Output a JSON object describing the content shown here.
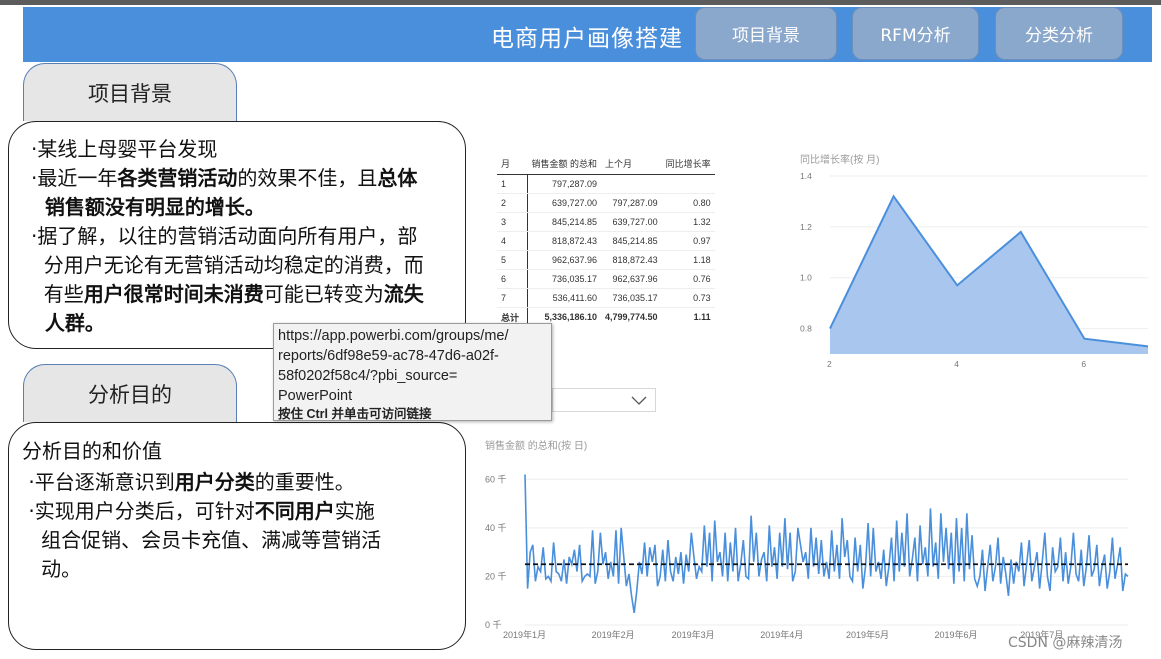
{
  "header": {
    "title": "电商用户画像搭建",
    "nav": [
      "项目背景",
      "RFM分析",
      "分类分析"
    ]
  },
  "section1": {
    "tab": "项目背景",
    "lines": [
      [
        {
          "t": "·某线上母婴平台发现",
          "b": false
        }
      ],
      [
        {
          "t": "·最近一年",
          "b": false
        },
        {
          "t": "各类营销活动",
          "b": true
        },
        {
          "t": "的效果不佳，且",
          "b": false
        },
        {
          "t": "总体",
          "b": true
        }
      ],
      [
        {
          "t": "  销售额没有明显的增长。",
          "b": true
        }
      ],
      [
        {
          "t": "·据了解，以往的营销活动面向所有用户，部",
          "b": false
        }
      ],
      [
        {
          "t": "  分用户无论有无营销活动均稳定的消费，而",
          "b": false
        }
      ],
      [
        {
          "t": "  有些",
          "b": false
        },
        {
          "t": "用户很常时间未消费",
          "b": true
        },
        {
          "t": "可能已转变为",
          "b": false
        },
        {
          "t": "流失",
          "b": true
        }
      ],
      [
        {
          "t": "  人群。",
          "b": true
        }
      ]
    ]
  },
  "section2": {
    "tab": "分析目的",
    "heading": "分析目的和价值",
    "lines": [
      [
        {
          "t": " ·平台逐渐意识到",
          "b": false
        },
        {
          "t": "用户分类",
          "b": true
        },
        {
          "t": "的重要性。",
          "b": false
        }
      ],
      [
        {
          "t": " ·实现用户分类后，可针对",
          "b": false
        },
        {
          "t": "不同用户",
          "b": true
        },
        {
          "t": "实施",
          "b": false
        }
      ],
      [
        {
          "t": "   组合促销、会员卡充值、满减等营销活",
          "b": false
        }
      ],
      [
        {
          "t": "   动。",
          "b": false
        }
      ]
    ]
  },
  "table": {
    "headers": [
      "月",
      "销售金额 的总和",
      "上个月",
      "同比增长率"
    ],
    "rows": [
      [
        "1",
        "797,287.09",
        "",
        ""
      ],
      [
        "2",
        "639,727.00",
        "797,287.09",
        "0.80"
      ],
      [
        "3",
        "845,214.85",
        "639,727.00",
        "1.32"
      ],
      [
        "4",
        "818,872.43",
        "845,214.85",
        "0.97"
      ],
      [
        "5",
        "962,637.96",
        "818,872.43",
        "1.18"
      ],
      [
        "6",
        "736,035.17",
        "962,637.96",
        "0.76"
      ],
      [
        "7",
        "536,411.60",
        "736,035.17",
        "0.73"
      ]
    ],
    "total": [
      "总计",
      "5,336,186.10",
      "4,799,774.50",
      "1.11"
    ]
  },
  "tooltip": {
    "url": "https://app.powerbi.com/groups/me/reports/6df98e59-ac78-47d6-a02f-58f0202f58c4/?pbi_source=PowerPoint",
    "lines": [
      "https://app.powerbi.com/groups/me/",
      "reports/6df98e59-ac78-47d6-a02f-",
      "58f0202f58c4/?pbi_source=",
      "PowerPoint"
    ],
    "hint": "按住 Ctrl 并单击可访问链接"
  },
  "watermark": "CSDN @麻辣清汤",
  "colors": {
    "header_bg": "#4a8fdc",
    "nav_bg": "#8aa7cc",
    "series": "#4a8fdc",
    "area_fill": "#a9c7ee"
  },
  "chart_data": [
    {
      "type": "area",
      "title": "同比增长率(按 月)",
      "x": [
        2,
        3,
        4,
        5,
        6,
        7
      ],
      "y": [
        0.8,
        1.32,
        0.97,
        1.18,
        0.76,
        0.73
      ],
      "xticks": [
        2,
        4,
        6
      ],
      "yticks": [
        0.8,
        1.0,
        1.2,
        1.4
      ],
      "xlim": [
        2,
        7
      ],
      "ylim": [
        0.7,
        1.4
      ],
      "grid": true
    },
    {
      "type": "line",
      "title": "销售金额 的总和(按 日)",
      "x_start": "2019-01-01",
      "xticks": [
        "2019年1月",
        "2019年2月",
        "2019年3月",
        "2019年4月",
        "2019年5月",
        "2019年6月",
        "2019年7月"
      ],
      "yticks": [
        "0 千",
        "20 千",
        "40 千",
        "60 千"
      ],
      "ylim": [
        0,
        63
      ],
      "reference_line": 25,
      "values": [
        62,
        15,
        30,
        33,
        18,
        24,
        22,
        32,
        19,
        20,
        18,
        34,
        22,
        21,
        18,
        27,
        17,
        28,
        25,
        31,
        22,
        33,
        18,
        20,
        21,
        20,
        39,
        17,
        22,
        38,
        25,
        30,
        19,
        26,
        20,
        39,
        17,
        40,
        28,
        16,
        21,
        12,
        5,
        14,
        26,
        21,
        34,
        20,
        32,
        26,
        33,
        16,
        20,
        31,
        18,
        35,
        22,
        18,
        28,
        21,
        30,
        17,
        29,
        22,
        38,
        28,
        19,
        24,
        22,
        41,
        24,
        38,
        18,
        43,
        26,
        30,
        20,
        38,
        18,
        34,
        22,
        40,
        18,
        25,
        35,
        20,
        19,
        45,
        26,
        38,
        20,
        27,
        30,
        18,
        41,
        24,
        32,
        19,
        38,
        24,
        44,
        23,
        38,
        18,
        22,
        40,
        33,
        26,
        30,
        19,
        40,
        24,
        36,
        21,
        35,
        20,
        26,
        19,
        39,
        22,
        33,
        19,
        44,
        28,
        35,
        20,
        18,
        36,
        22,
        33,
        15,
        24,
        42,
        20,
        40,
        22,
        26,
        19,
        31,
        16,
        24,
        36,
        18,
        43,
        22,
        38,
        24,
        46,
        20,
        27,
        36,
        18,
        41,
        25,
        32,
        20,
        48,
        24,
        34,
        19,
        46,
        26,
        40,
        23,
        38,
        17,
        44,
        22,
        40,
        18,
        46,
        23,
        37,
        19,
        16,
        20,
        31,
        14,
        24,
        33,
        18,
        24,
        36,
        17,
        28,
        21,
        12,
        27,
        17,
        26,
        22,
        34,
        16,
        25,
        35,
        18,
        24,
        30,
        15,
        26,
        38,
        20,
        14,
        32,
        22,
        24,
        36,
        18,
        30,
        17,
        24,
        38,
        21,
        18,
        31,
        16,
        24,
        37,
        20,
        23,
        33,
        16,
        24,
        29,
        15,
        22,
        36,
        19,
        25,
        32,
        14,
        21,
        20
      ]
    }
  ]
}
